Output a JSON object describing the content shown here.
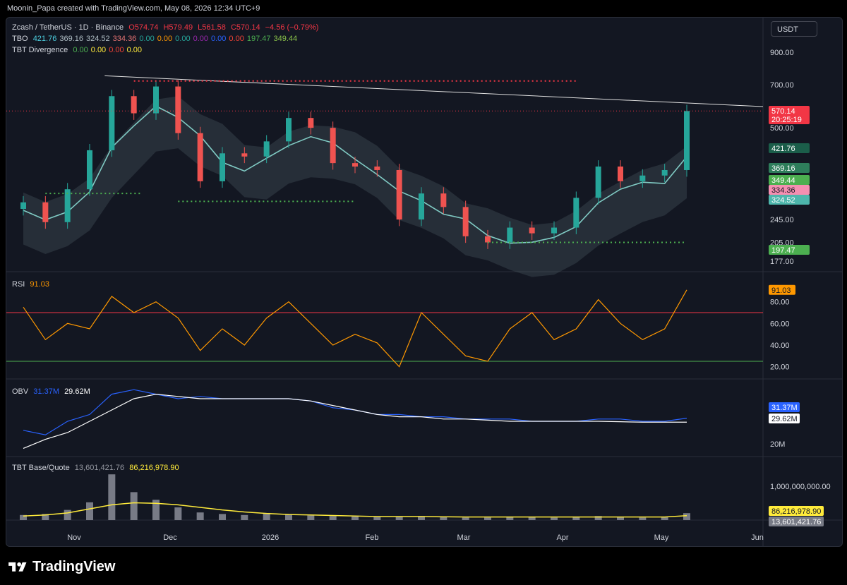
{
  "attribution": "Moonin_Papa created with TradingView.com, May 08, 2026 12:34 UTC+9",
  "currency_button": "USDT",
  "brand": "TradingView",
  "legend": {
    "main": {
      "symbol": "Zcash / TetherUS · 1D · Binance",
      "o": "O574.74",
      "h": "H579.49",
      "l": "L561.58",
      "c": "C570.14",
      "chg": "−4.56 (−0.79%)"
    },
    "tbo": {
      "name": "TBO",
      "values": [
        "421.76",
        "369.16",
        "324.52",
        "334.36",
        "0.00",
        "0.00",
        "0.00",
        "0.00",
        "0.00",
        "0.00",
        "197.47",
        "349.44"
      ],
      "colors": [
        "#4dd0e1",
        "#b0bec5",
        "#b0bec5",
        "#e57373",
        "#26a69a",
        "#ff9800",
        "#26a69a",
        "#9c27b0",
        "#2962ff",
        "#f44336",
        "#4caf50",
        "#8bc34a"
      ]
    },
    "div": {
      "name": "TBT Divergence",
      "values": [
        "0.00",
        "0.00",
        "0.00",
        "0.00"
      ],
      "colors": [
        "#4caf50",
        "#ffeb3b",
        "#f44336",
        "#ffeb3b"
      ]
    },
    "rsi": {
      "name": "RSI",
      "value": "91.03"
    },
    "obv": {
      "name": "OBV",
      "v1": "31.37M",
      "v2": "29.62M"
    },
    "vol": {
      "name": "TBT Base/Quote",
      "v1": "13,601,421.76",
      "v2": "86,216,978.90"
    }
  },
  "chart_data": [
    {
      "type": "candlestick",
      "title": "Zcash / TetherUS · 1D · Binance",
      "scale": "log",
      "ylim": [
        165,
        1000
      ],
      "y_ticks": [
        "900.00",
        "700.00",
        "500.00",
        "245.00",
        "205.00",
        "177.00"
      ],
      "x_ticks": [
        "Nov",
        "Dec",
        "2026",
        "Feb",
        "Mar",
        "Apr",
        "May",
        "Jun"
      ],
      "series": [
        {
          "name": "Close",
          "dates": [
            "Oct 08",
            "Oct 15",
            "Oct 22",
            "Oct 29",
            "Nov 05",
            "Nov 12",
            "Nov 19",
            "Nov 26",
            "Dec 03",
            "Dec 10",
            "Dec 17",
            "Dec 24",
            "Dec 31",
            "Jan 07",
            "Jan 14",
            "Jan 21",
            "Jan 28",
            "Feb 04",
            "Feb 11",
            "Feb 18",
            "Feb 25",
            "Mar 04",
            "Mar 11",
            "Mar 18",
            "Mar 25",
            "Apr 01",
            "Apr 08",
            "Apr 15",
            "Apr 22",
            "Apr 29",
            "May 06"
          ],
          "values": [
            280,
            240,
            310,
            420,
            640,
            560,
            690,
            480,
            330,
            410,
            400,
            450,
            540,
            500,
            380,
            370,
            360,
            245,
            300,
            270,
            215,
            205,
            230,
            220,
            230,
            290,
            370,
            330,
            345,
            360,
            570
          ]
        }
      ],
      "price_labels": [
        {
          "value": "570.14",
          "sub": "20:25:19",
          "color": "#f23645"
        },
        {
          "value": "421.76",
          "color": "#1b5e4a"
        },
        {
          "value": "369.16",
          "color": "#2e7d5b"
        },
        {
          "value": "349.44",
          "color": "#4caf50"
        },
        {
          "value": "334.36",
          "color": "#f48fb1"
        },
        {
          "value": "324.52",
          "color": "#4db6ac"
        },
        {
          "value": "197.47",
          "color": "#4caf50"
        }
      ]
    },
    {
      "type": "line",
      "title": "RSI",
      "ylim": [
        10,
        100
      ],
      "y_ticks": [
        "80.00",
        "60.00",
        "40.00",
        "20.00"
      ],
      "levels": [
        70,
        25
      ],
      "series": [
        {
          "name": "RSI",
          "values": [
            75,
            45,
            60,
            55,
            85,
            70,
            80,
            65,
            35,
            55,
            40,
            65,
            80,
            60,
            40,
            50,
            42,
            20,
            70,
            50,
            30,
            25,
            55,
            70,
            45,
            55,
            82,
            60,
            45,
            55,
            91
          ]
        }
      ]
    },
    {
      "type": "line",
      "title": "OBV",
      "ylim": [
        15,
        45
      ],
      "y_ticks": [
        "20M"
      ],
      "series": [
        {
          "name": "OBV",
          "values": [
            26,
            24,
            30,
            33,
            42,
            44,
            42,
            40,
            41,
            40,
            40,
            40,
            40,
            39,
            36,
            35,
            33,
            33,
            32,
            32,
            31,
            31,
            31,
            30,
            30,
            30,
            31,
            31,
            30,
            30,
            31.37
          ]
        },
        {
          "name": "OBV MA",
          "values": [
            18,
            22,
            25,
            30,
            35,
            40,
            42,
            41,
            40,
            40,
            40,
            40,
            40,
            39,
            37,
            35,
            33,
            32,
            32,
            31,
            31,
            30.5,
            30,
            30,
            30,
            30,
            30,
            29.8,
            29.6,
            29.6,
            29.62
          ]
        }
      ]
    },
    {
      "type": "bar",
      "title": "TBT Base/Quote",
      "y_ticks": [
        "1,000,000,000.00"
      ],
      "series": [
        {
          "name": "Base/Quote",
          "values": [
            10,
            12,
            20,
            35,
            90,
            55,
            40,
            25,
            15,
            12,
            10,
            14,
            12,
            9,
            8,
            7,
            6,
            7,
            8,
            6,
            5,
            5,
            7,
            6,
            5,
            6,
            8,
            6,
            5,
            6,
            13.6
          ]
        },
        {
          "name": "MA",
          "values": [
            8,
            10,
            14,
            22,
            30,
            34,
            33,
            30,
            25,
            20,
            16,
            13,
            11,
            10,
            9,
            8,
            7,
            7,
            7,
            6.5,
            6,
            6,
            6,
            6,
            6,
            6,
            6,
            6,
            6,
            6,
            8.6
          ]
        }
      ]
    }
  ]
}
